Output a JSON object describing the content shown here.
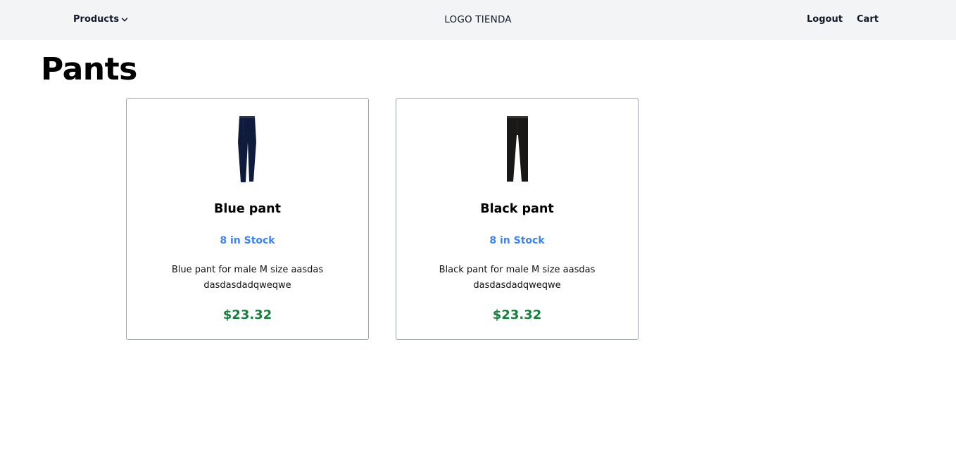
{
  "navbar": {
    "products_label": "Products",
    "products_icon": "chevron-down-icon",
    "logo_text": "LOGO TIENDA",
    "logout_label": "Logout",
    "cart_label": "Cart"
  },
  "page": {
    "title": "Pants"
  },
  "products": [
    {
      "name": "Blue pant",
      "stock": "8 in Stock",
      "description": "Blue pant for male M size aasdasdasdasdadqweqwe",
      "price": "$23.32",
      "image": "blue-pant-image",
      "color": "#0f1b3d"
    },
    {
      "name": "Black pant",
      "stock": "8 in Stock",
      "description": "Black pant for male M size aasdasdasdasdadqweqwe",
      "price": "$23.32",
      "image": "black-pant-image",
      "color": "#1a1717"
    }
  ],
  "colors": {
    "navbar_bg": "#f3f4f6",
    "stock": "#3b82f6",
    "price": "#15803d",
    "card_border": "#9ca3af"
  }
}
